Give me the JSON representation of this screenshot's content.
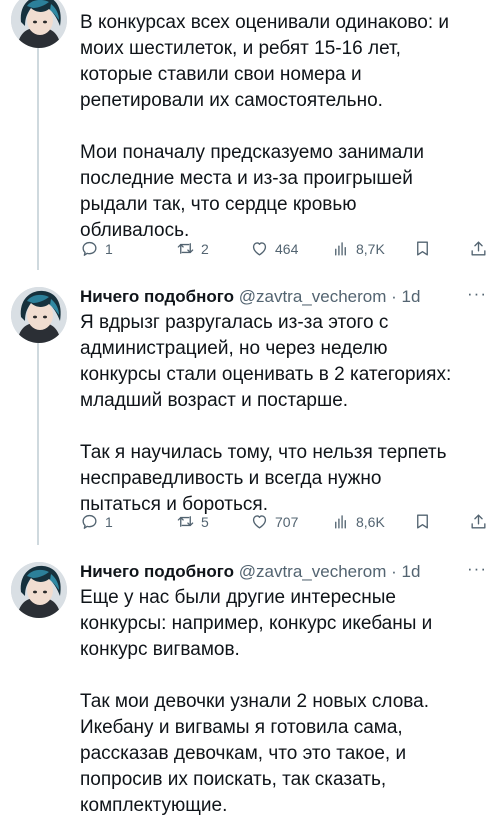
{
  "tweets": [
    {
      "paragraphs": [
        [
          "В конкурсах всех оценивали одинаково: и",
          "моих шестилеток, и ребят 15-16 лет,",
          "которые ставили свои номера и",
          "репетировали их самостоятельно."
        ],
        [
          "Мои поначалу предсказуемо занимали",
          "последние места и из-за проигрышей",
          "рыдали так, что сердце кровью",
          "обливалось."
        ]
      ],
      "stats": {
        "replies": "1",
        "retweets": "2",
        "likes": "464",
        "views": "8,7K"
      }
    },
    {
      "name": "Ничего подобного",
      "handle": "@zavtra_vecherom",
      "time": "· 1d",
      "more": "···",
      "paragraphs": [
        [
          "Я вдрызг разругалась из-за этого с",
          "администрацией, но через неделю",
          "конкурсы стали оценивать в 2 категориях:",
          "младший возраст и постарше."
        ],
        [
          "Так я научилась тому, что нельзя терпеть",
          "несправедливость и всегда нужно",
          "пытаться и бороться."
        ]
      ],
      "stats": {
        "replies": "1",
        "retweets": "5",
        "likes": "707",
        "views": "8,6K"
      }
    },
    {
      "name": "Ничего подобного",
      "handle": "@zavtra_vecherom",
      "time": "· 1d",
      "more": "···",
      "paragraphs": [
        [
          "Еще у нас были другие интересные",
          "конкурсы: например, конкурс икебаны и",
          "конкурс вигвамов."
        ],
        [
          "Так мои девочки узнали 2 новых слова.",
          "Икебану и вигвамы я готовила сама,",
          "рассказав девочкам, что это такое, и",
          "попросив их поискать, так сказать,",
          "комплектующие."
        ]
      ]
    }
  ],
  "icons": [
    "reply-icon",
    "retweet-icon",
    "like-icon",
    "views-icon",
    "bookmark-icon",
    "share-icon",
    "more-icon"
  ],
  "colors": {
    "text": "#0f1419",
    "secondary": "#536471",
    "thread_line": "#cfd9de",
    "background": "#ffffff"
  }
}
